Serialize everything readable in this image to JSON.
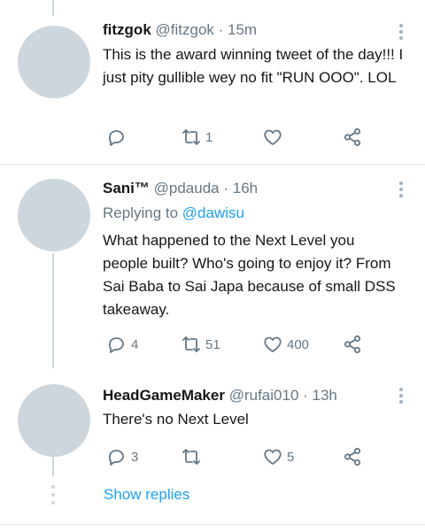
{
  "tweets": [
    {
      "name": "fitzgok",
      "handle": "@fitzgok",
      "time": "15m",
      "replying_prefix": "",
      "replying_mention": "",
      "text": "This is the award winning tweet of the day!!! I just pity gullible wey no fit \"RUN OOO\". LOL",
      "reply_count": "",
      "retweet_count": "1",
      "like_count": ""
    },
    {
      "name": "Sani™",
      "handle": "@pdauda",
      "time": "16h",
      "replying_prefix": "Replying to ",
      "replying_mention": "@dawisu",
      "text": "What happened to the Next Level you people built? Who's going to enjoy it? From Sai Baba to Sai Japa because of small DSS takeaway.",
      "reply_count": "4",
      "retweet_count": "51",
      "like_count": "400"
    },
    {
      "name": "HeadGameMaker",
      "handle": "@rufai010",
      "time": "13h",
      "replying_prefix": "",
      "replying_mention": "",
      "text": "There's no Next Level",
      "reply_count": "3",
      "retweet_count": "",
      "like_count": "5"
    }
  ],
  "separator": " · ",
  "show_replies_label": "Show replies",
  "icons": {
    "reply": "reply-icon",
    "retweet": "retweet-icon",
    "like": "heart-icon",
    "share": "share-icon",
    "more": "more-icon"
  },
  "colors": {
    "accent": "#1da1f2",
    "secondary_text": "#657786",
    "avatar_placeholder": "#cdd6dd",
    "thread_line": "#ccd6dd"
  }
}
